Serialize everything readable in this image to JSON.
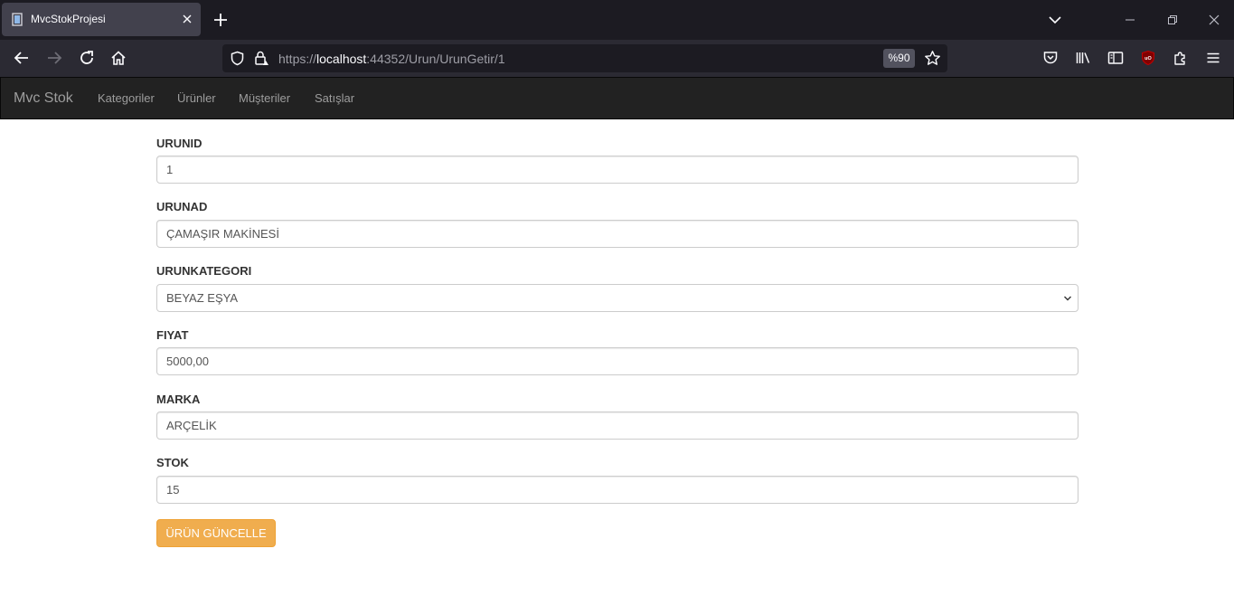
{
  "browser": {
    "tab_title": "MvcStokProjesi",
    "url_prefix": "https://",
    "url_host": "localhost",
    "url_path": ":44352/Urun/UrunGetir/1",
    "zoom": "%90"
  },
  "site": {
    "brand": "Mvc Stok",
    "nav": [
      "Kategoriler",
      "Ürünler",
      "Müşteriler",
      "Satışlar"
    ]
  },
  "form": {
    "urunid": {
      "label": "URUNID",
      "value": "1"
    },
    "urunad": {
      "label": "URUNAD",
      "value": "ÇAMAŞIR MAKİNESİ"
    },
    "urunkategori": {
      "label": "URUNKATEGORI",
      "value": "BEYAZ EŞYA"
    },
    "fiyat": {
      "label": "FIYAT",
      "value": "5000,00"
    },
    "marka": {
      "label": "MARKA",
      "value": "ARÇELİK"
    },
    "stok": {
      "label": "STOK",
      "value": "15"
    },
    "submit_label": "ÜRÜN GÜNCELLE"
  },
  "colors": {
    "navbar_bg": "#222222",
    "button_warning": "#f0ad4e"
  }
}
